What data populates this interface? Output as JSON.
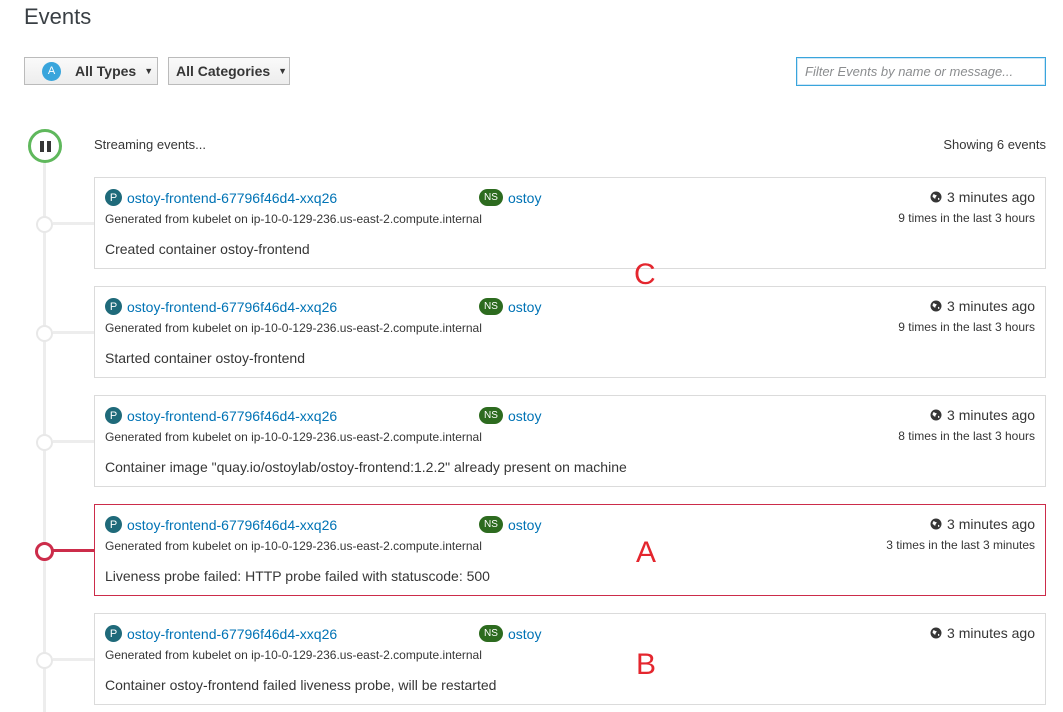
{
  "page": {
    "title": "Events"
  },
  "toolbar": {
    "types_badge": "A",
    "types_label": "All Types",
    "categories_label": "All Categories",
    "filter_placeholder": "Filter Events by name or message..."
  },
  "stream": {
    "status": "Streaming events...",
    "showing": "Showing 6 events"
  },
  "icons": {
    "pause": "pause-icon",
    "globe": "globe-icon",
    "caret": "caret-down-icon"
  },
  "colors": {
    "accent": "#0073b5",
    "error": "#cc2c4a",
    "success": "#5fb85c",
    "annotation": "#e4262e"
  },
  "events": [
    {
      "badge": "P",
      "resource": "ostoy-frontend-67796f46d4-xxq26",
      "ns_badge": "NS",
      "namespace": "ostoy",
      "source": "Generated from kubelet on ip-10-0-129-236.us-east-2.compute.internal",
      "message": "Created container ostoy-frontend",
      "time": "3 minutes ago",
      "count": "9 times in the last 3 hours",
      "error": false
    },
    {
      "badge": "P",
      "resource": "ostoy-frontend-67796f46d4-xxq26",
      "ns_badge": "NS",
      "namespace": "ostoy",
      "source": "Generated from kubelet on ip-10-0-129-236.us-east-2.compute.internal",
      "message": "Started container ostoy-frontend",
      "time": "3 minutes ago",
      "count": "9 times in the last 3 hours",
      "error": false
    },
    {
      "badge": "P",
      "resource": "ostoy-frontend-67796f46d4-xxq26",
      "ns_badge": "NS",
      "namespace": "ostoy",
      "source": "Generated from kubelet on ip-10-0-129-236.us-east-2.compute.internal",
      "message": "Container image \"quay.io/ostoylab/ostoy-frontend:1.2.2\" already present on machine",
      "time": "3 minutes ago",
      "count": "8 times in the last 3 hours",
      "error": false
    },
    {
      "badge": "P",
      "resource": "ostoy-frontend-67796f46d4-xxq26",
      "ns_badge": "NS",
      "namespace": "ostoy",
      "source": "Generated from kubelet on ip-10-0-129-236.us-east-2.compute.internal",
      "message": "Liveness probe failed: HTTP probe failed with statuscode: 500",
      "time": "3 minutes ago",
      "count": "3 times in the last 3 minutes",
      "error": true
    },
    {
      "badge": "P",
      "resource": "ostoy-frontend-67796f46d4-xxq26",
      "ns_badge": "NS",
      "namespace": "ostoy",
      "source": "Generated from kubelet on ip-10-0-129-236.us-east-2.compute.internal",
      "message": "Container ostoy-frontend failed liveness probe, will be restarted",
      "time": "3 minutes ago",
      "count": "",
      "error": false
    }
  ],
  "annotations": {
    "c": "C",
    "a": "A",
    "b": "B"
  }
}
